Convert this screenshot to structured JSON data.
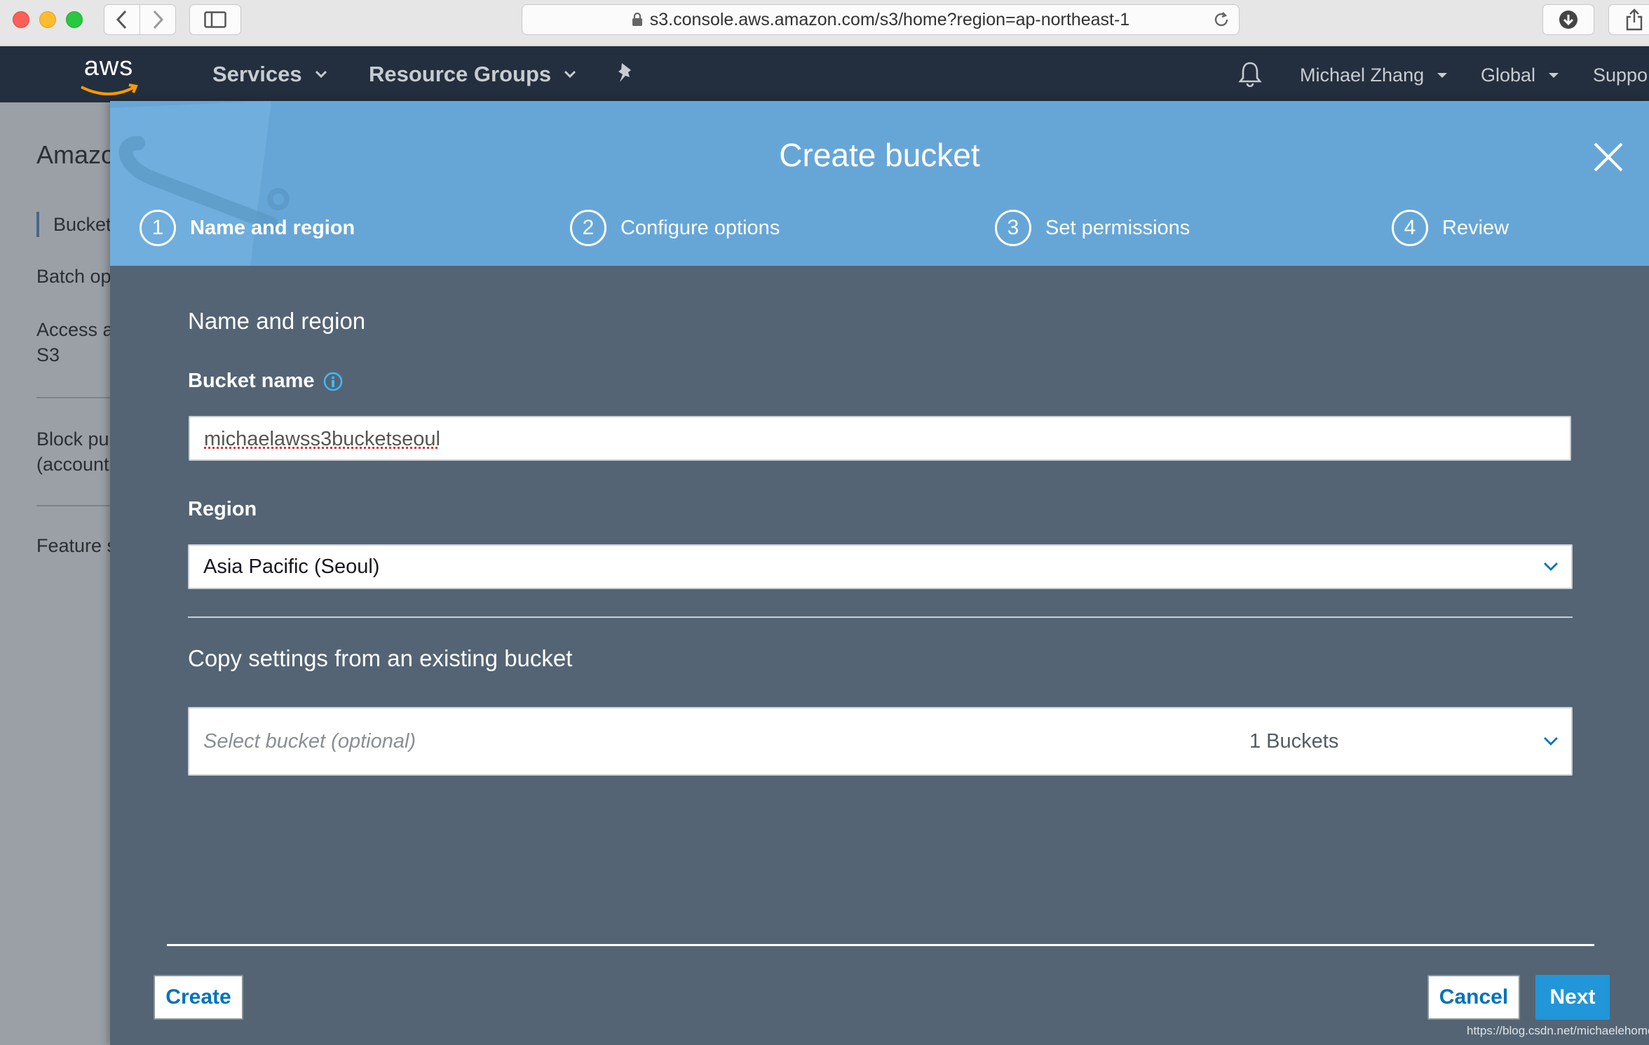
{
  "browser": {
    "url": "s3.console.aws.amazon.com/s3/home?region=ap-northeast-1"
  },
  "aws_header": {
    "logo": "aws",
    "services_label": "Services",
    "resource_groups_label": "Resource Groups",
    "user_label": "Michael Zhang",
    "region_label": "Global",
    "support_label": "Suppo"
  },
  "sidebar": {
    "title": "Amazo",
    "items": [
      {
        "label": "Bucket"
      },
      {
        "label": "Batch op"
      },
      {
        "label_line1": "Access a",
        "label_line2": "S3"
      },
      {
        "label_line1": "Block pu",
        "label_line2": "(account"
      },
      {
        "label": "Feature s"
      }
    ]
  },
  "modal": {
    "title": "Create bucket",
    "steps": [
      {
        "number": "1",
        "label": "Name and region"
      },
      {
        "number": "2",
        "label": "Configure options"
      },
      {
        "number": "3",
        "label": "Set permissions"
      },
      {
        "number": "4",
        "label": "Review"
      }
    ],
    "section_title": "Name and region",
    "bucket_name_label": "Bucket name",
    "bucket_name_value": "michaelawss3bucketseoul",
    "region_label": "Region",
    "region_value": "Asia Pacific (Seoul)",
    "copy_title": "Copy settings from an existing bucket",
    "copy_placeholder": "Select bucket (optional)",
    "copy_count": "1 Buckets",
    "buttons": {
      "create": "Create",
      "cancel": "Cancel",
      "next": "Next"
    }
  },
  "watermark": "https://blog.csdn.net/michaelehome",
  "colors": {
    "aws_header": "#232f3e",
    "modal_header": "#66a6d7",
    "modal_body": "#546474",
    "primary_button": "#2196d8",
    "link_blue": "#0073bb"
  }
}
